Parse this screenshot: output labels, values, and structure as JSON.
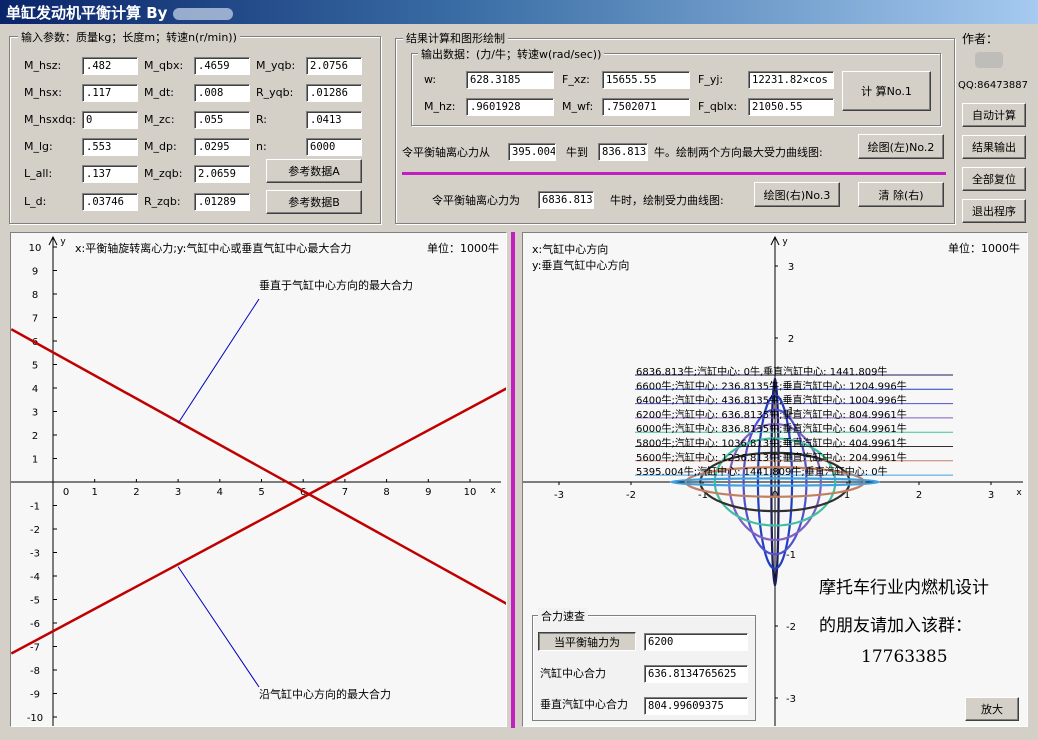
{
  "window": {
    "title": "单缸发动机平衡计算 By"
  },
  "input_group": {
    "title": "输入参数：质量kg；长度m；转速n(r/min))",
    "rows": [
      [
        {
          "label": "M_hsz:",
          "value": ".482"
        },
        {
          "label": "M_qbx:",
          "value": ".4659"
        },
        {
          "label": "M_yqb:",
          "value": "2.0756"
        }
      ],
      [
        {
          "label": "M_hsx:",
          "value": ".117"
        },
        {
          "label": "M_dt:",
          "value": ".008"
        },
        {
          "label": "R_yqb:",
          "value": ".01286"
        }
      ],
      [
        {
          "label": "M_hsxdq:",
          "value": "0"
        },
        {
          "label": "M_zc:",
          "value": ".055"
        },
        {
          "label": "R:",
          "value": ".0413"
        }
      ],
      [
        {
          "label": "M_lg:",
          "value": ".553"
        },
        {
          "label": "M_dp:",
          "value": ".0295"
        },
        {
          "label": "n:",
          "value": "6000"
        }
      ],
      [
        {
          "label": "L_all:",
          "value": ".137"
        },
        {
          "label": "M_zqb:",
          "value": "2.0659"
        }
      ],
      [
        {
          "label": "L_d:",
          "value": ".03746"
        },
        {
          "label": "R_zqb:",
          "value": ".01289"
        }
      ]
    ],
    "ref_a": "参考数据A",
    "ref_b": "参考数据B"
  },
  "result_group": {
    "title": "结果计算和图形绘制",
    "output_title": "输出数据：(力/牛；转速w(rad/sec))",
    "w_label": "w:",
    "w_value": "628.3185",
    "fxz_label": "F_xz:",
    "fxz_value": "15655.55",
    "fyj_label": "F_yj:",
    "fyj_value": "12231.82×cos",
    "mhz_label": "M_hz:",
    "mhz_value": ".9601928",
    "mwf_label": "M_wf:",
    "mwf_value": ".7502071",
    "fqblx_label": "F_qblx:",
    "fqblx_value": "21050.55",
    "calc_button": "计  算No.1",
    "range_prefix": "令平衡轴离心力从",
    "range_from": "395.004",
    "range_mid": "牛到",
    "range_to": "836.813",
    "range_suffix": "牛。绘制两个方向最大受力曲线图:",
    "plot_left_button": "绘图(左)No.2",
    "force_prefix": "令平衡轴离心力为",
    "force_value": "6836.813",
    "force_suffix": "牛时，绘制受力曲线图:",
    "plot_right_button": "绘图(右)No.3",
    "clear_right_button": "清 除(右)"
  },
  "side": {
    "author_label": "作者：",
    "qq": "QQ:86473887",
    "auto_calc": "自动计算",
    "output_results": "结果输出",
    "reset_all": "全部复位",
    "exit": "退出程序"
  },
  "left_chart": {
    "legend": "x:平衡轴旋转离心力;y:气缸中心或垂直气缸中心最大合力",
    "unit": "单位：1000牛",
    "annotation_top": "垂直于气缸中心方向的最大合力",
    "annotation_bottom": "沿气缸中心方向的最大合力",
    "axis_x": "x",
    "axis_y": "y",
    "x_ticks": [
      "0",
      "1",
      "2",
      "3",
      "4",
      "5",
      "6",
      "7",
      "8",
      "9",
      "10"
    ],
    "y_ticks": [
      "10",
      "9",
      "8",
      "7",
      "6",
      "5",
      "4",
      "3",
      "2",
      "1",
      "-1",
      "-2",
      "-3",
      "-4",
      "-5",
      "-6",
      "-7",
      "-8",
      "-9",
      "-10"
    ],
    "line_color": "#c00000"
  },
  "right_chart": {
    "legend_x": "x:气缸中心方向",
    "legend_y": "y:垂直气缸中心方向",
    "unit": "单位：1000牛",
    "axis_x": "x",
    "axis_y": "y",
    "x_ticks": [
      "-3",
      "-2",
      "-1",
      "0",
      "1",
      "2",
      "3"
    ],
    "y_ticks": [
      "3",
      "2",
      "1",
      "-1",
      "-2",
      "-3"
    ],
    "curve_labels": [
      "6836.813牛;汽缸中心: 0牛,垂直汽缸中心: 1441.809牛",
      "6600牛;汽缸中心: 236.8135牛;垂直汽缸中心: 1204.996牛",
      "6400牛;汽缸中心: 436.8135牛;垂直汽缸中心: 1004.996牛",
      "6200牛;汽缸中心: 636.8135牛;垂直汽缸中心: 804.9961牛",
      "6000牛;汽缸中心: 836.8135牛;垂直汽缸中心: 604.9961牛",
      "5800牛;汽缸中心: 1036.813牛;垂直汽缸中心: 404.9961牛",
      "5600牛;汽缸中心: 1236.813牛;垂直汽缸中心: 204.9961牛",
      "5395.004牛;汽缸中心: 1441.809牛;垂直汽缸中心: 0牛"
    ],
    "curve_colors": [
      "#1e1e5a",
      "#2040c0",
      "#5050d0",
      "#8060c0",
      "#40c0a0",
      "#303030",
      "#c08060",
      "#40a0e0"
    ],
    "promo_line1": "摩托车行业内燃机设计",
    "promo_line2": "的朋友请加入该群：",
    "promo_line3": "17763385",
    "enlarge_button": "放大"
  },
  "quick_query": {
    "title": "合力速查",
    "balance_button": "当平衡轴力为",
    "balance_value": "6200",
    "cyl_label": "汽缸中心合力",
    "cyl_value": "636.8134765625",
    "perp_label": "垂直汽缸中心合力",
    "perp_value": "804.99609375"
  }
}
